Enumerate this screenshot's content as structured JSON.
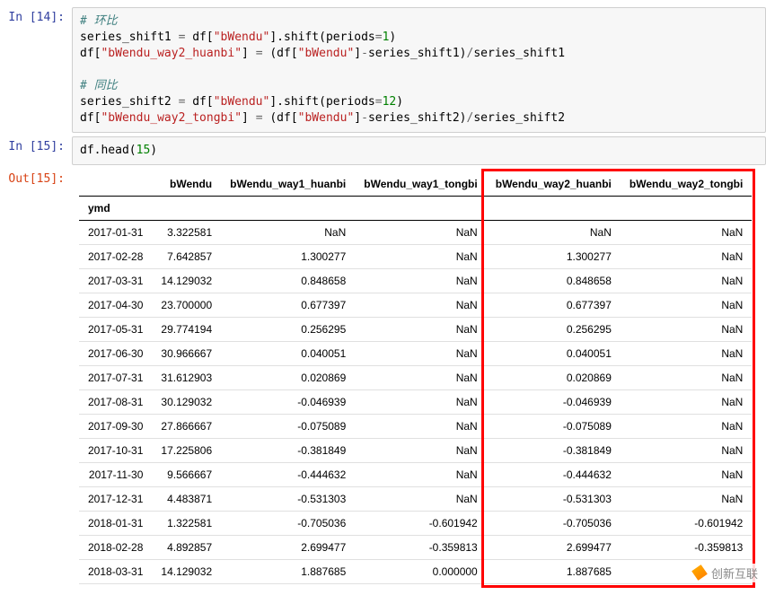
{
  "cells": {
    "c14": {
      "prompt": "In [14]:"
    },
    "c15": {
      "prompt": "In [15]:",
      "out_prompt": "Out[15]:"
    }
  },
  "code14": {
    "comment1": "# 环比",
    "l1a": "series_shift1 ",
    "l1b": " df[",
    "l1s": "\"bWendu\"",
    "l1c": "].shift(periods",
    "l1n": "1",
    "l1d": ")",
    "l2a": "df[",
    "l2s1": "\"bWendu_way2_huanbi\"",
    "l2b": "] ",
    "l2c": " (df[",
    "l2s2": "\"bWendu\"",
    "l2d": "]",
    "l2e": "series_shift1)",
    "l2f": "series_shift1",
    "comment2": "# 同比",
    "l3a": "series_shift2 ",
    "l3b": " df[",
    "l3s": "\"bWendu\"",
    "l3c": "].shift(periods",
    "l3n": "12",
    "l3d": ")",
    "l4a": "df[",
    "l4s1": "\"bWendu_way2_tongbi\"",
    "l4b": "] ",
    "l4c": " (df[",
    "l4s2": "\"bWendu\"",
    "l4d": "]",
    "l4e": "series_shift2)",
    "l4f": "series_shift2"
  },
  "code15": {
    "a": "df.head(",
    "n": "15",
    "b": ")"
  },
  "table": {
    "index_name": "ymd",
    "columns": [
      "bWendu",
      "bWendu_way1_huanbi",
      "bWendu_way1_tongbi",
      "bWendu_way2_huanbi",
      "bWendu_way2_tongbi"
    ],
    "rows": [
      {
        "idx": "2017-01-31",
        "v": [
          "3.322581",
          "NaN",
          "NaN",
          "NaN",
          "NaN"
        ]
      },
      {
        "idx": "2017-02-28",
        "v": [
          "7.642857",
          "1.300277",
          "NaN",
          "1.300277",
          "NaN"
        ]
      },
      {
        "idx": "2017-03-31",
        "v": [
          "14.129032",
          "0.848658",
          "NaN",
          "0.848658",
          "NaN"
        ]
      },
      {
        "idx": "2017-04-30",
        "v": [
          "23.700000",
          "0.677397",
          "NaN",
          "0.677397",
          "NaN"
        ]
      },
      {
        "idx": "2017-05-31",
        "v": [
          "29.774194",
          "0.256295",
          "NaN",
          "0.256295",
          "NaN"
        ]
      },
      {
        "idx": "2017-06-30",
        "v": [
          "30.966667",
          "0.040051",
          "NaN",
          "0.040051",
          "NaN"
        ]
      },
      {
        "idx": "2017-07-31",
        "v": [
          "31.612903",
          "0.020869",
          "NaN",
          "0.020869",
          "NaN"
        ]
      },
      {
        "idx": "2017-08-31",
        "v": [
          "30.129032",
          "-0.046939",
          "NaN",
          "-0.046939",
          "NaN"
        ]
      },
      {
        "idx": "2017-09-30",
        "v": [
          "27.866667",
          "-0.075089",
          "NaN",
          "-0.075089",
          "NaN"
        ]
      },
      {
        "idx": "2017-10-31",
        "v": [
          "17.225806",
          "-0.381849",
          "NaN",
          "-0.381849",
          "NaN"
        ]
      },
      {
        "idx": "2017-11-30",
        "v": [
          "9.566667",
          "-0.444632",
          "NaN",
          "-0.444632",
          "NaN"
        ]
      },
      {
        "idx": "2017-12-31",
        "v": [
          "4.483871",
          "-0.531303",
          "NaN",
          "-0.531303",
          "NaN"
        ]
      },
      {
        "idx": "2018-01-31",
        "v": [
          "1.322581",
          "-0.705036",
          "-0.601942",
          "-0.705036",
          "-0.601942"
        ]
      },
      {
        "idx": "2018-02-28",
        "v": [
          "4.892857",
          "2.699477",
          "-0.359813",
          "2.699477",
          "-0.359813"
        ]
      },
      {
        "idx": "2018-03-31",
        "v": [
          "14.129032",
          "1.887685",
          "0.000000",
          "1.887685",
          ""
        ]
      }
    ]
  },
  "watermark": {
    "text": "创新互联"
  },
  "chart_data": {
    "type": "table",
    "title": "",
    "index_name": "ymd",
    "columns": [
      "bWendu",
      "bWendu_way1_huanbi",
      "bWendu_way1_tongbi",
      "bWendu_way2_huanbi",
      "bWendu_way2_tongbi"
    ],
    "index": [
      "2017-01-31",
      "2017-02-28",
      "2017-03-31",
      "2017-04-30",
      "2017-05-31",
      "2017-06-30",
      "2017-07-31",
      "2017-08-31",
      "2017-09-30",
      "2017-10-31",
      "2017-11-30",
      "2017-12-31",
      "2018-01-31",
      "2018-02-28",
      "2018-03-31"
    ],
    "data": [
      [
        3.322581,
        null,
        null,
        null,
        null
      ],
      [
        7.642857,
        1.300277,
        null,
        1.300277,
        null
      ],
      [
        14.129032,
        0.848658,
        null,
        0.848658,
        null
      ],
      [
        23.7,
        0.677397,
        null,
        0.677397,
        null
      ],
      [
        29.774194,
        0.256295,
        null,
        0.256295,
        null
      ],
      [
        30.966667,
        0.040051,
        null,
        0.040051,
        null
      ],
      [
        31.612903,
        0.020869,
        null,
        0.020869,
        null
      ],
      [
        30.129032,
        -0.046939,
        null,
        -0.046939,
        null
      ],
      [
        27.866667,
        -0.075089,
        null,
        -0.075089,
        null
      ],
      [
        17.225806,
        -0.381849,
        null,
        -0.381849,
        null
      ],
      [
        9.566667,
        -0.444632,
        null,
        -0.444632,
        null
      ],
      [
        4.483871,
        -0.531303,
        null,
        -0.531303,
        null
      ],
      [
        1.322581,
        -0.705036,
        -0.601942,
        -0.705036,
        -0.601942
      ],
      [
        4.892857,
        2.699477,
        -0.359813,
        2.699477,
        -0.359813
      ],
      [
        14.129032,
        1.887685,
        0.0,
        1.887685,
        null
      ]
    ]
  }
}
